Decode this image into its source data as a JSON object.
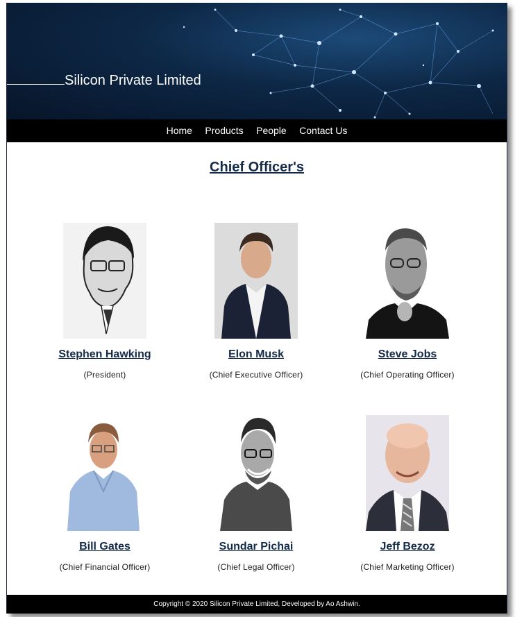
{
  "header": {
    "brand": "Silicon Private Limited"
  },
  "nav": {
    "items": [
      "Home",
      "Products",
      "People",
      "Contact Us"
    ]
  },
  "main": {
    "title": "Chief Officer's",
    "officers": [
      {
        "name": "Stephen Hawking",
        "role": "(President)",
        "photo": "stephen-hawking-photo"
      },
      {
        "name": "Elon Musk",
        "role": "(Chief Executive Officer)",
        "photo": "elon-musk-photo"
      },
      {
        "name": "Steve Jobs",
        "role": "(Chief Operating Officer)",
        "photo": "steve-jobs-photo"
      },
      {
        "name": "Bill Gates",
        "role": "(Chief Financial Officer)",
        "photo": "bill-gates-photo"
      },
      {
        "name": "Sundar Pichai",
        "role": "(Chief Legal Officer)",
        "photo": "sundar-pichai-photo"
      },
      {
        "name": "Jeff Bezoz",
        "role": "(Chief Marketing Officer)",
        "photo": "jeff-bezos-photo"
      }
    ]
  },
  "footer": {
    "text": "Copyright © 2020 Silicon Private Limited, Developed by Ao Ashwin."
  },
  "colors": {
    "header_bg": "#0d2745",
    "nav_bg": "#000000",
    "title_color": "#132a4a",
    "footer_bg": "#000000"
  }
}
